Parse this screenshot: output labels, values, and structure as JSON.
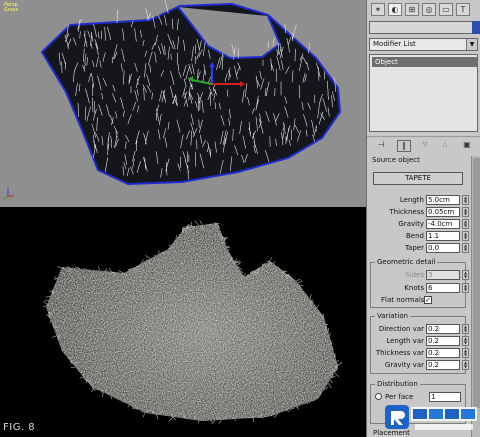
{
  "viewport_top": {
    "label_line1": "Persp",
    "label_line2": "Grass"
  },
  "figure_label": "FIG. 8",
  "panel": {
    "tab_icons": [
      "create-icon",
      "modify-icon",
      "hierarchy-icon",
      "motion-icon",
      "display-icon",
      "utilities-icon"
    ],
    "modifier_list": "Modifier List",
    "stack_item": "Object",
    "stack_tool_icons": [
      "pin-stack-icon",
      "show-end-result-icon",
      "make-unique-icon",
      "remove-modifier-icon",
      "configure-sets-icon"
    ],
    "source_object": {
      "title": "Source object",
      "pick_button": "TAPETE"
    },
    "params": [
      {
        "label": "Length",
        "value": "5.0cm"
      },
      {
        "label": "Thickness",
        "value": "0.05cm"
      },
      {
        "label": "Gravity",
        "value": "-4.0cm"
      },
      {
        "label": "Bend",
        "value": "1.1"
      },
      {
        "label": "Taper",
        "value": "0.0"
      }
    ],
    "geometric_detail": {
      "title": "Geometric detail",
      "sides_label": "Sides",
      "sides_value": "3",
      "knots_label": "Knots",
      "knots_value": "6",
      "flat_normals_label": "Flat normals",
      "flat_normals_checked": "✓"
    },
    "variation": {
      "title": "Variation",
      "items": [
        {
          "label": "Direction var",
          "value": "0.2"
        },
        {
          "label": "Length var",
          "value": "0.2"
        },
        {
          "label": "Thickness var",
          "value": "0.2"
        },
        {
          "label": "Gravity var",
          "value": "0.2"
        }
      ]
    },
    "distribution": {
      "title": "Distribution",
      "per_face_label": "Per face",
      "per_face_value": "1"
    },
    "footer": "Placement"
  },
  "colors": {
    "viewport_bg": "#8f8f8f",
    "panel_bg": "#c8c8c8",
    "mesh": "#14161c",
    "outline": "#1d2bd0"
  }
}
